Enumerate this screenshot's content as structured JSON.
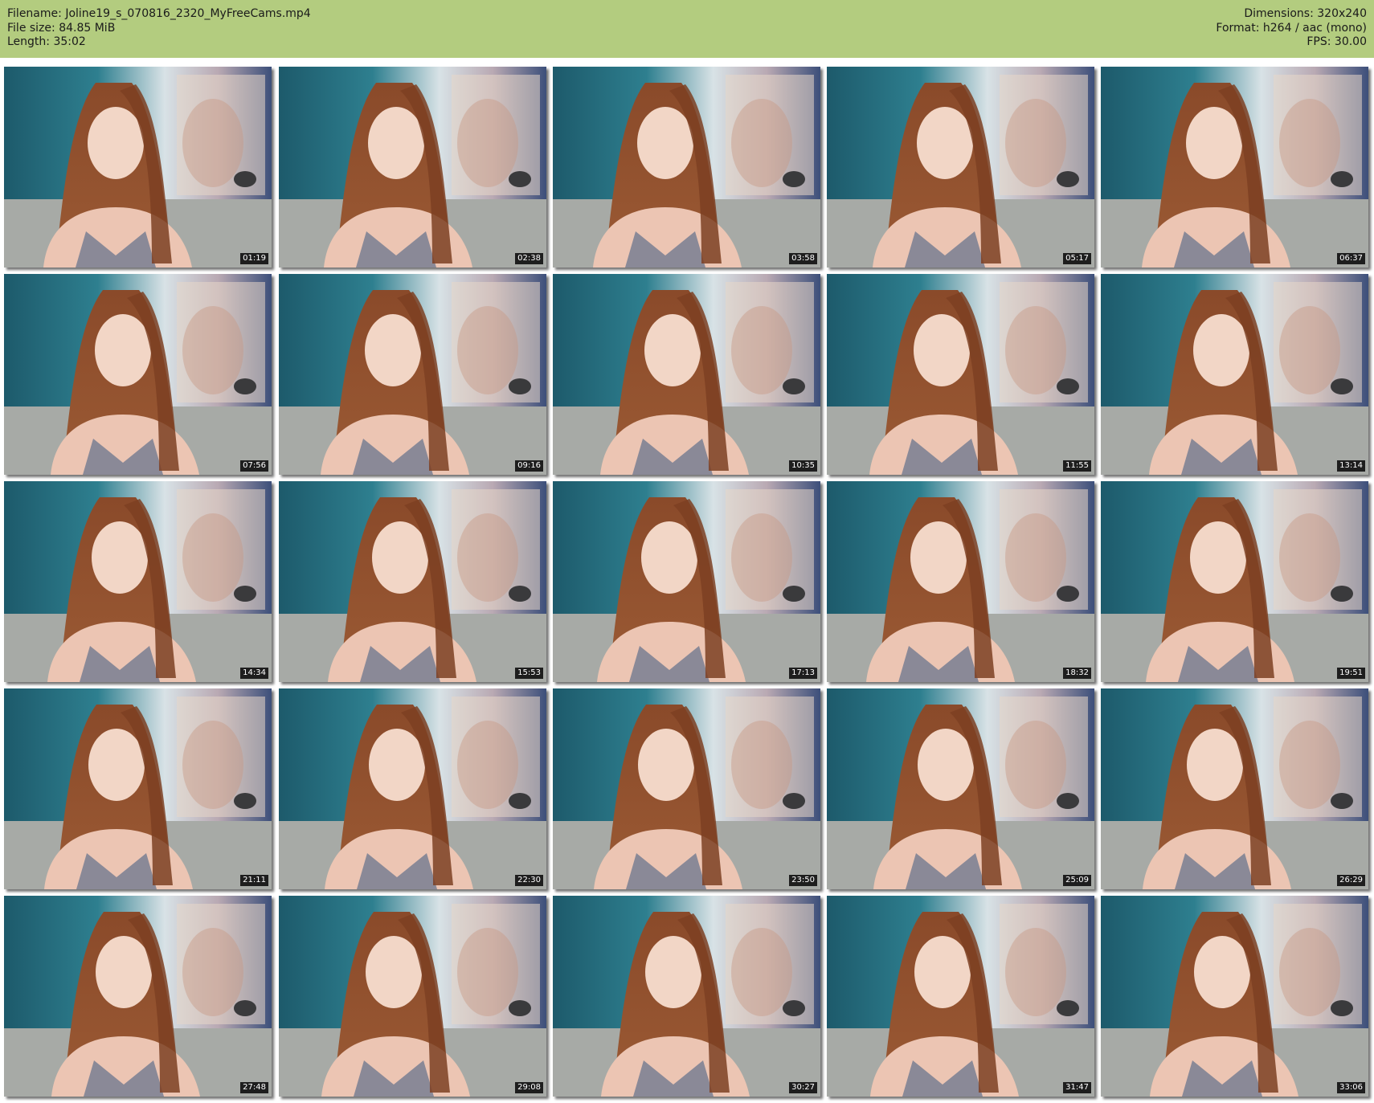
{
  "header": {
    "left": [
      {
        "label": "Filename:",
        "value": "Joline19_s_070816_2320_MyFreeCams.mp4"
      },
      {
        "label": "File size:",
        "value": "84.85 MiB"
      },
      {
        "label": "Length:",
        "value": "35:02"
      }
    ],
    "right": [
      {
        "label": "Dimensions:",
        "value": "320x240"
      },
      {
        "label": "Format:",
        "value": "h264 / aac (mono)"
      },
      {
        "label": "FPS:",
        "value": "30.00"
      }
    ]
  },
  "thumbnails": [
    {
      "timestamp": "01:19"
    },
    {
      "timestamp": "02:38"
    },
    {
      "timestamp": "03:58"
    },
    {
      "timestamp": "05:17"
    },
    {
      "timestamp": "06:37"
    },
    {
      "timestamp": "07:56"
    },
    {
      "timestamp": "09:16"
    },
    {
      "timestamp": "10:35"
    },
    {
      "timestamp": "11:55"
    },
    {
      "timestamp": "13:14"
    },
    {
      "timestamp": "14:34"
    },
    {
      "timestamp": "15:53"
    },
    {
      "timestamp": "17:13"
    },
    {
      "timestamp": "18:32"
    },
    {
      "timestamp": "19:51"
    },
    {
      "timestamp": "21:11"
    },
    {
      "timestamp": "22:30"
    },
    {
      "timestamp": "23:50"
    },
    {
      "timestamp": "25:09"
    },
    {
      "timestamp": "26:29"
    },
    {
      "timestamp": "27:48"
    },
    {
      "timestamp": "29:08"
    },
    {
      "timestamp": "30:27"
    },
    {
      "timestamp": "31:47"
    },
    {
      "timestamp": "33:06"
    }
  ],
  "colors": {
    "header_bg": "#b3cc7f",
    "timestamp_bg": "#1e1e1e",
    "timestamp_text": "#ffffff"
  }
}
